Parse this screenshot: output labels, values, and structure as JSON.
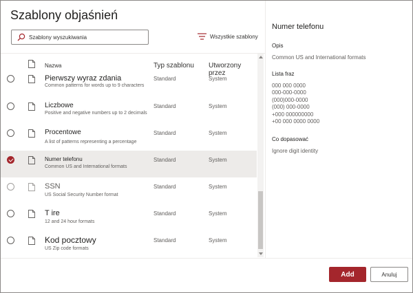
{
  "dialog": {
    "title": "Szablony objaśnień"
  },
  "search": {
    "placeholder": "Szablony wyszukiwania",
    "value": ""
  },
  "filter": {
    "label": "Wszystkie szablony"
  },
  "list": {
    "headers": {
      "name": "Nazwa",
      "type": "Typ szablonu",
      "created_by": "Utworzony przez"
    },
    "rows": [
      {
        "name": "Pierwszy wyraz zdania",
        "desc": "Common patterns for words up to 9 characters",
        "type": "Standard",
        "created_by": "System",
        "selected": false
      },
      {
        "name": "Liczbowe",
        "desc": "Positive and negative numbers up to 2 decimals",
        "type": "Standard",
        "created_by": "System",
        "selected": false
      },
      {
        "name": "Procentowe",
        "desc": "A list of patterns representing a percentage",
        "type": "Standard",
        "created_by": "System",
        "selected": false
      },
      {
        "name": "Numer telefonu",
        "desc": "Common US and International formats",
        "type": "Standard",
        "created_by": "System",
        "selected": true
      },
      {
        "name": "SSN",
        "desc": "US Social Security Number format",
        "type": "Standard",
        "created_by": "System",
        "selected": false
      },
      {
        "name": "T ire",
        "desc": "12 and 24 hour formats",
        "type": "Standard",
        "created_by": "System",
        "selected": false
      },
      {
        "name": "Kod pocztowy",
        "desc": "US Zip code formats",
        "type": "Standard",
        "created_by": "System",
        "selected": false
      }
    ]
  },
  "details": {
    "title": "Numer telefonu",
    "description_label": "Opis",
    "description": "Common US and International formats",
    "phrase_list_label": "Lista fraz",
    "phrases": [
      "000 000 0000",
      "000-000-0000",
      "(000)000-0000",
      "(000) 000-0000",
      "+000 000000000",
      "+00 000 0000 0000"
    ],
    "match_label": "Co dopasować",
    "match_value": "Ignore digit identity"
  },
  "buttons": {
    "add": "Add",
    "cancel": "Anuluj"
  },
  "colors": {
    "accent": "#a4262c",
    "selected_row": "#edebe9"
  }
}
